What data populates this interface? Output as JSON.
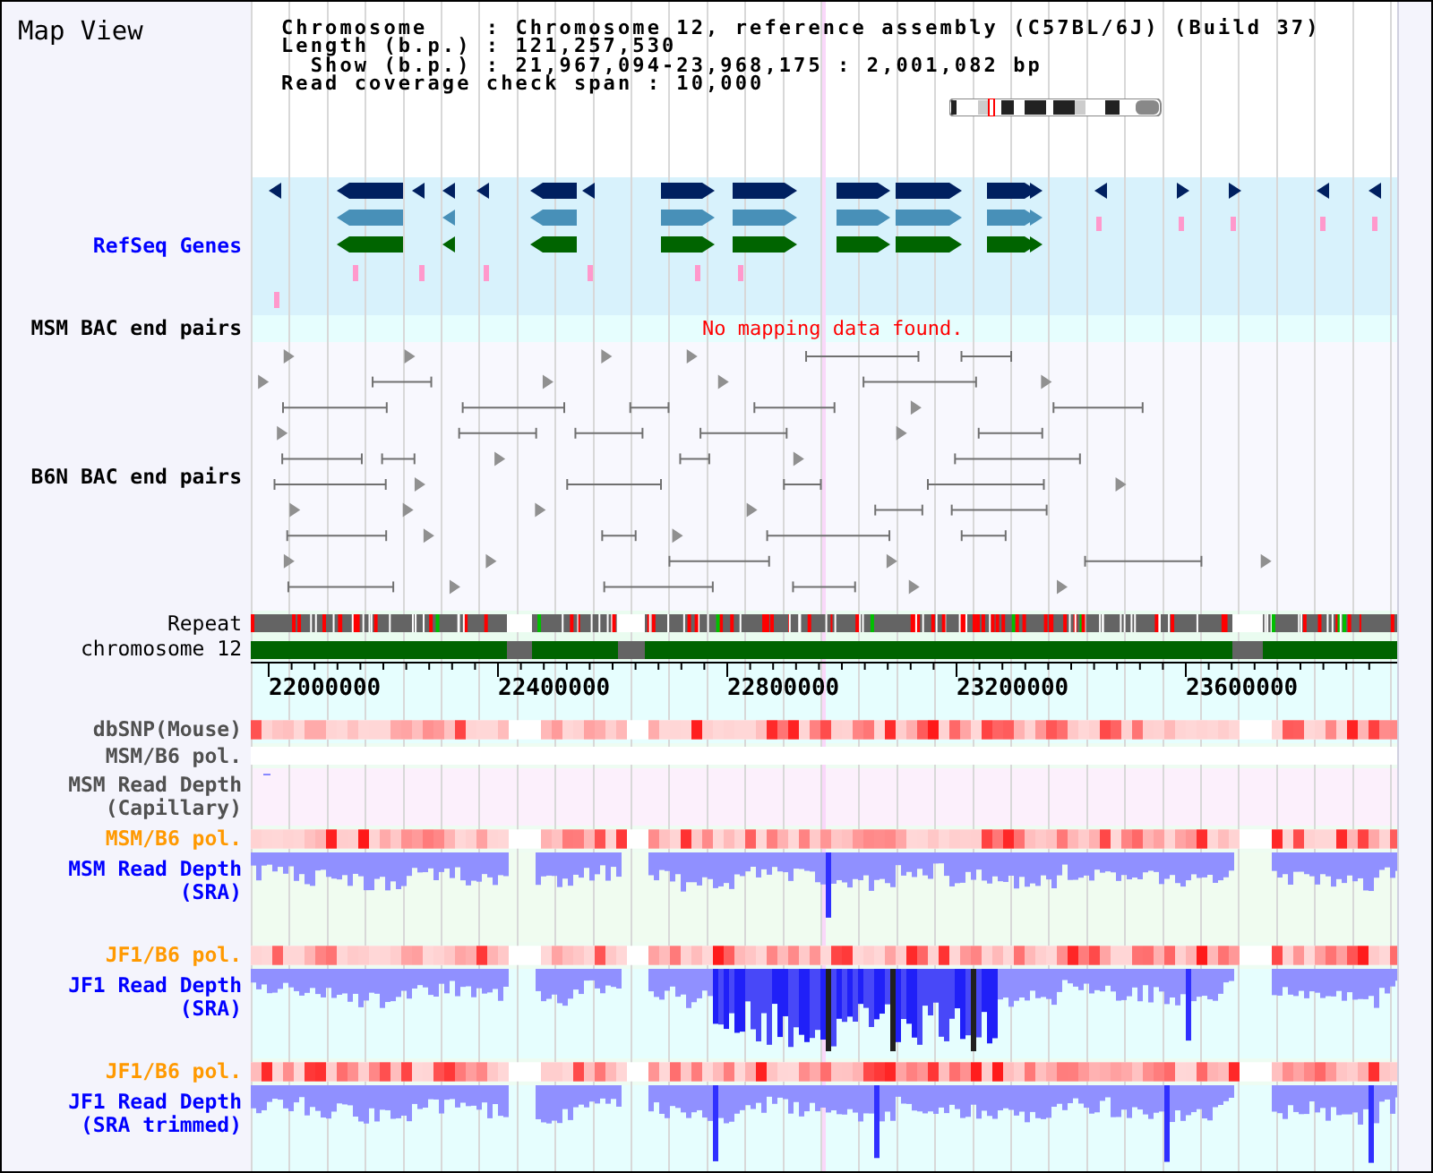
{
  "title": "Map View",
  "header": {
    "lines": [
      "Chromosome    : Chromosome 12, reference assembly (C57BL/6J) (Build 37)",
      "Length (b.p.) : 121,257,530",
      "  Show (b.p.) : 21,967,094-23,968,175 : 2,001,082 bp",
      "Read coverage check span : 10,000"
    ]
  },
  "tracks": [
    {
      "kind": "genes",
      "label": "RefSeq Genes",
      "color": "#0000ff"
    },
    {
      "kind": "bac",
      "label": "MSM BAC end pairs",
      "color": "#000000",
      "message": "No mapping data found."
    },
    {
      "kind": "bac",
      "label": "B6N BAC end pairs",
      "color": "#000000"
    },
    {
      "kind": "repeat",
      "label": "Repeat",
      "color": "#000000"
    },
    {
      "kind": "chromosome",
      "label": "chromosome 12",
      "color": "#000000"
    },
    {
      "kind": "axis",
      "labels": [
        "22000000",
        "22400000",
        "22800000",
        "23200000",
        "23600000"
      ]
    },
    {
      "kind": "heat",
      "label": "dbSNP(Mouse)",
      "color": "#505050",
      "empty": false
    },
    {
      "kind": "heat",
      "label": "MSM/B6 pol.",
      "color": "#505050",
      "empty": true
    },
    {
      "kind": "depth",
      "label": "MSM Read Depth\n(Capillary)",
      "color": "#505050",
      "empty": true,
      "dense": false
    },
    {
      "kind": "heat",
      "label": "MSM/B6 pol.",
      "color": "#ff9900",
      "empty": false
    },
    {
      "kind": "depth",
      "label": "MSM Read Depth\n(SRA)",
      "color": "#0000ff",
      "empty": false,
      "dense": false
    },
    {
      "kind": "heat",
      "label": "JF1/B6 pol.",
      "color": "#ff9900",
      "empty": false
    },
    {
      "kind": "depth",
      "label": "JF1 Read Depth\n(SRA)",
      "color": "#0000ff",
      "empty": false,
      "dense": true
    },
    {
      "kind": "heat",
      "label": "JF1/B6 pol.",
      "color": "#ff9900",
      "empty": false
    },
    {
      "kind": "depth",
      "label": "JF1 Read Depth\n(SRA trimmed)",
      "color": "#0000ff",
      "empty": false,
      "dense": false
    }
  ]
}
